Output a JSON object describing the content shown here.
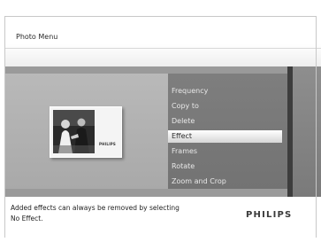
{
  "header": {
    "title": "Photo Menu"
  },
  "preview": {
    "thumbnail_brand": "PHILIPS"
  },
  "menu": {
    "items": [
      {
        "label": "Frequency"
      },
      {
        "label": "Copy to"
      },
      {
        "label": "Delete"
      },
      {
        "label": "Effect",
        "selected": true
      },
      {
        "label": "Frames"
      },
      {
        "label": "Rotate"
      },
      {
        "label": "Zoom and Crop"
      }
    ]
  },
  "footer": {
    "help_line1": "Added effects can always be removed by selecting",
    "help_line2": "No Effect.",
    "brand": "PHILIPS"
  },
  "colors": {
    "selection_highlight": "#ffffff",
    "menu_background": "#7a7a7a",
    "preview_background": "#b3b3b3"
  }
}
